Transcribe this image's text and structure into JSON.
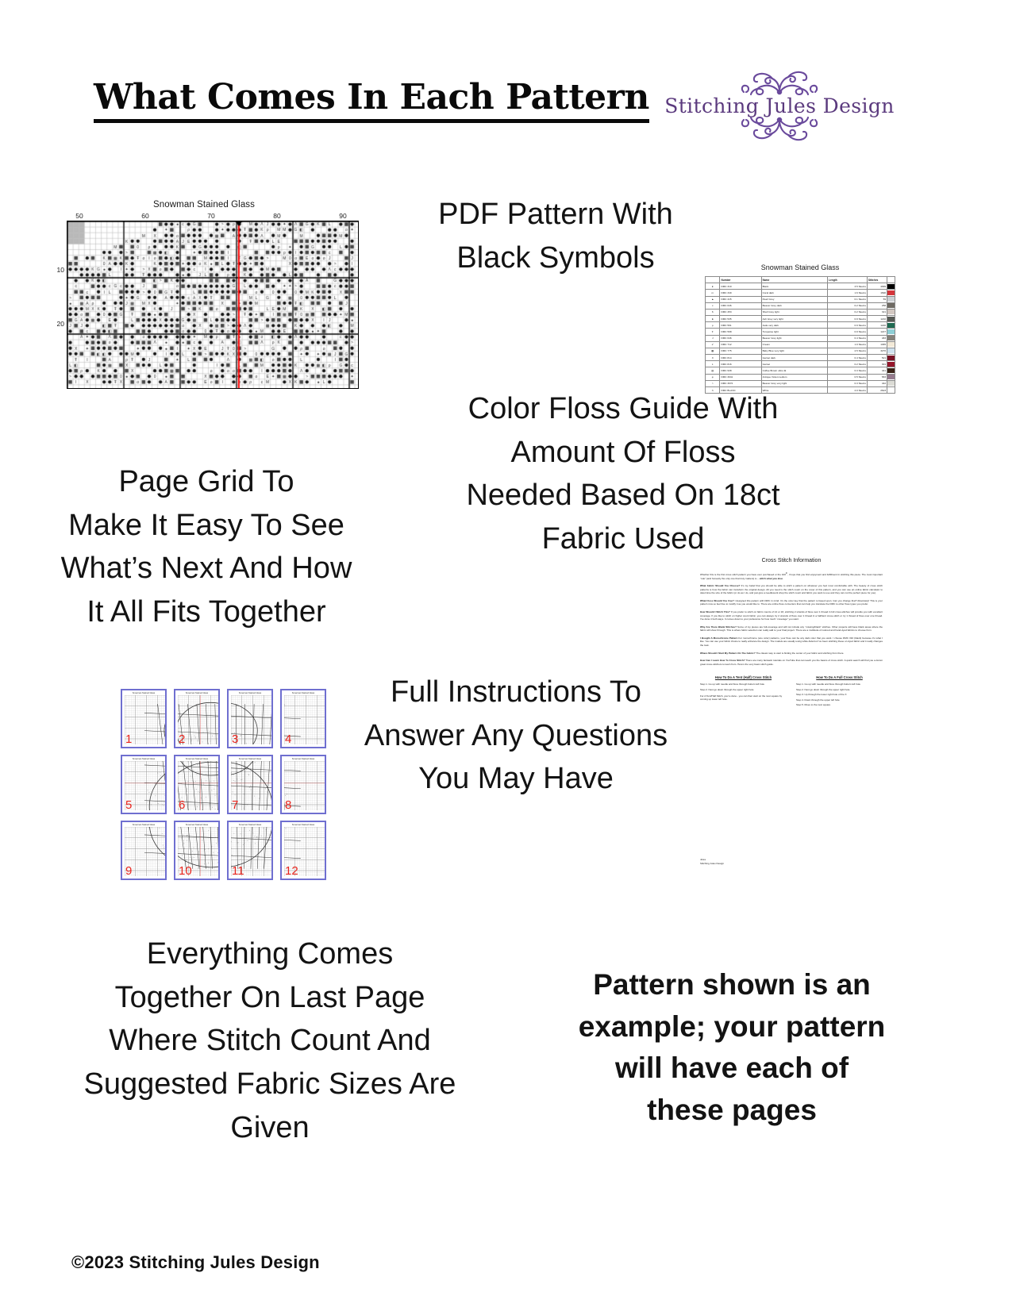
{
  "header": {
    "title": "What Comes In Each Pattern",
    "logo": {
      "brand_name": "Stitching Jules Design",
      "color": "#5b3a7e",
      "flourish_icon": "floral-scroll-ornament"
    }
  },
  "callouts": {
    "pdf_pattern": "PDF Pattern With\nBlack Symbols",
    "page_grid": "Page Grid To\nMake It Easy To See\nWhat’s Next And How\nIt All Fits Together",
    "floss_guide": "Color Floss Guide With\nAmount Of Floss\nNeeded Based On 18ct\nFabric Used",
    "instructions": "Full Instructions To\nAnswer Any Questions\nYou May Have",
    "everything": "Everything Comes\nTogether On Last Page\nWhere Stitch Count And\nSuggested Fabric Sizes Are\nGiven",
    "example_note": "Pattern shown is an\nexample; your pattern\nwill have each of\nthese pages"
  },
  "footer": {
    "copyright": "©2023 Stitching Jules Design"
  },
  "chart": {
    "title": "Snowman Stained Glass",
    "column_labels": [
      "50",
      "60",
      "70",
      "80",
      "90"
    ],
    "row_labels": [
      "10",
      "20"
    ],
    "center_marker_color": "#ff0000",
    "grid_line_color": "#000000"
  },
  "floss_guide": {
    "title": "Snowman Stained Glass",
    "columns": [
      "",
      "Number",
      "Name",
      "Length",
      "Stitches"
    ],
    "rows": [
      {
        "symbol": "●",
        "number": "DMC   310",
        "name": "Black",
        "length": "3.5 Skeins",
        "stitches": "4999",
        "swatch": "#000000"
      },
      {
        "symbol": "m",
        "number": "DMC   349",
        "name": "Coral dark",
        "length": "1.6 Skeins",
        "stitches": "1690",
        "swatch": "#d4353b"
      },
      {
        "symbol": "▲",
        "number": "DMC   415",
        "name": "Pearl Grey",
        "length": "0.1 Skeins",
        "stitches": "59",
        "swatch": "#cdd0d4"
      },
      {
        "symbol": "c",
        "number": "DMC   646",
        "name": "Beaver Grey dark",
        "length": "0.2 Skeins",
        "stitches": "258",
        "swatch": "#6f6b64"
      },
      {
        "symbol": "6",
        "number": "DMC   453",
        "name": "Shell Grey light",
        "length": "0.2 Skeins",
        "stitches": "321",
        "swatch": "#d3c8c2"
      },
      {
        "symbol": "E",
        "number": "DMC   535",
        "name": "Ash Grey very light",
        "length": "0.9 Skeins",
        "stitches": "1210",
        "swatch": "#575a55"
      },
      {
        "symbol": "ρ",
        "number": "DMC   561",
        "name": "Jade very dark",
        "length": "0.9 Skeins",
        "stitches": "1220",
        "swatch": "#1f6b52"
      },
      {
        "symbol": "Ŧ",
        "number": "DMC   598",
        "name": "Turquoise light",
        "length": "0.9 Skeins",
        "stitches": "1227",
        "swatch": "#8fcfd6"
      },
      {
        "symbol": "J",
        "number": "DMC   646",
        "name": "Beaver Grey light",
        "length": "0.4 Skeins",
        "stitches": "483",
        "swatch": "#85817a"
      },
      {
        "symbol": "✔",
        "number": "DMC   712",
        "name": "Cream",
        "length": "1.0 Skeins",
        "stitches": "1365",
        "swatch": "#f3ead8"
      },
      {
        "symbol": "▩",
        "number": "DMC   775",
        "name": "Baby Blue very light",
        "length": "2.5 Skeins",
        "stitches": "3270",
        "swatch": "#cfe2ef"
      },
      {
        "symbol": "X",
        "number": "DMC   814",
        "name": "Garnet dark",
        "length": "0.4 Skeins",
        "stitches": "521",
        "swatch": "#7a1326"
      },
      {
        "symbol": "L",
        "number": "DMC   816",
        "name": "Garnet",
        "length": "0.2 Skeins",
        "stitches": "301",
        "swatch": "#95162b"
      },
      {
        "symbol": "▨",
        "number": "DMC   938",
        "name": "Coffee Brown ultra dk",
        "length": "0.3 Skeins",
        "stitches": "441",
        "swatch": "#3a2317"
      },
      {
        "symbol": "φ",
        "number": "DMC   3041",
        "name": "Antique Violet medium",
        "length": "0.5 Skeins",
        "stitches": "583",
        "swatch": "#967b8e"
      },
      {
        "symbol": ">",
        "number": "DMC   3072",
        "name": "Beaver Grey very light",
        "length": "0.3 Skeins",
        "stitches": "442",
        "swatch": "#dcdcd6"
      },
      {
        "symbol": "Λ",
        "number": "DMC   BLANC",
        "name": "White",
        "length": "2.0 Skeins",
        "stitches": "2623",
        "swatch": "#ffffff"
      }
    ]
  },
  "page_grid": {
    "thumbnail_title": "Snowman Stained Glass",
    "page_numbers": [
      "1",
      "2",
      "3",
      "4",
      "5",
      "6",
      "7",
      "8",
      "9",
      "10",
      "11",
      "12"
    ],
    "number_color": "#e8241c",
    "border_color": "#6f6fd0"
  },
  "instructions_sheet": {
    "title": "Cross Stitch Information",
    "intro_plain_1": "Whether this is the first cross stitch pattern you have ever purchased or the 100",
    "intro_plain_2": "th, I hope that you find enjoyment and fulfillment in stitching this piece. The most important “rule” (and honestly the only one that truly matters) is – ",
    "intro_emphasis": "stitch what you love.",
    "sections": [
      {
        "question": "What Fabric Should You Choose?",
        "answer": " It’s my belief that you should be able to stitch a pattern on whatever you feel most comfortable with. The beauty of cross stitch patterns is how the fabric can transform the original design.  All you need is the stitch count on the cover of this pattern, and you can use an online fabric calculator to determine the size of the fabric (or do as I do, and just give a needlework shop the stitch count and fabric you want to use and they can cut the perfect piece for you)."
      },
      {
        "question": "What Floss Should You Use?",
        "answer": " I designed this pattern with DMC in mind. It’s the color key that the pattern is based upon. Can you change that? Absolutely! This is your pattern now so feel free to modify it as you would like to.  There are online floss converters that can help you translate the DMC to other floss types you prefer."
      },
      {
        "question": "How Should I Stitch This?",
        "answer": " If you prefer to stitch on fabric counts of 14 or 18, stitching 2 strands of floss over 1 thread in full cross-stitches will provide you with excellent coverage. If you like to stitch on higher count fabric, you can always try 2 strands of floss over 1 thread in a half/tent cross-stitch or try 1 thread of floss over one thread. I’ve done it both ways. It comes down to your preference for how much “coverage” you want."
      },
      {
        "question": "Why Are There Blank Stitches?",
        "answer": " Some of my pieces are full-coverage and will not include any “missing/blank” stitches. Other projects will have blank areas where the fabric will show through. This is where fabric selection can really add to your final project. There are a multitude of colored and hand-dyed fabrics to choose from."
      },
      {
        "question": "I Bought A Monochrome Pattern",
        "answer": " For monochrome (one color) patterns, your floss can be any dark color that you want. I choose DMC 310 (black) because it’s what I like. You can use your fabric choice to really enhance the design. The models are usually using white Aida but I’ve been stitching these on dyed fabric and it really changes the look."
      },
      {
        "question": "Where Should I Start My Pattern On The Fabric?",
        "answer": " The classic way to start is finding the center of your fabric and stitching from there."
      },
      {
        "question": "How Can I Learn How To Cross Stitch?",
        "answer": " There are many fantastic tutorials on YouTube that can teach you the basics of cross stitch. A quick search will find you a dozen great cross-stitchers to learn from. Here’s the very basic stitch guide."
      }
    ],
    "tent_stitch": {
      "heading": "How To Do A Tent (Half) Cross Stitch",
      "steps": [
        "Step 1. Go up with needle and floss through bottom left hole",
        "Step 2. Next go down through the upper right hole"
      ],
      "note": "For A Tent/Half Stitch, you’re done - you can then start on the next square by coming up lower left hole."
    },
    "full_stitch": {
      "heading": "How To Do A Full Cross Stitch",
      "steps": [
        "Step 1. Go up with needle and floss through bottom left hole",
        "Step 2. Next go down through the upper right hole",
        "Step 3. Up through the lower right hole of the X",
        "Step 4. Down through the upper left hole",
        "Step 5. Move to the next square"
      ]
    },
    "signature_line_1": "Jules",
    "signature_line_2": "Stitching Jules Design"
  }
}
